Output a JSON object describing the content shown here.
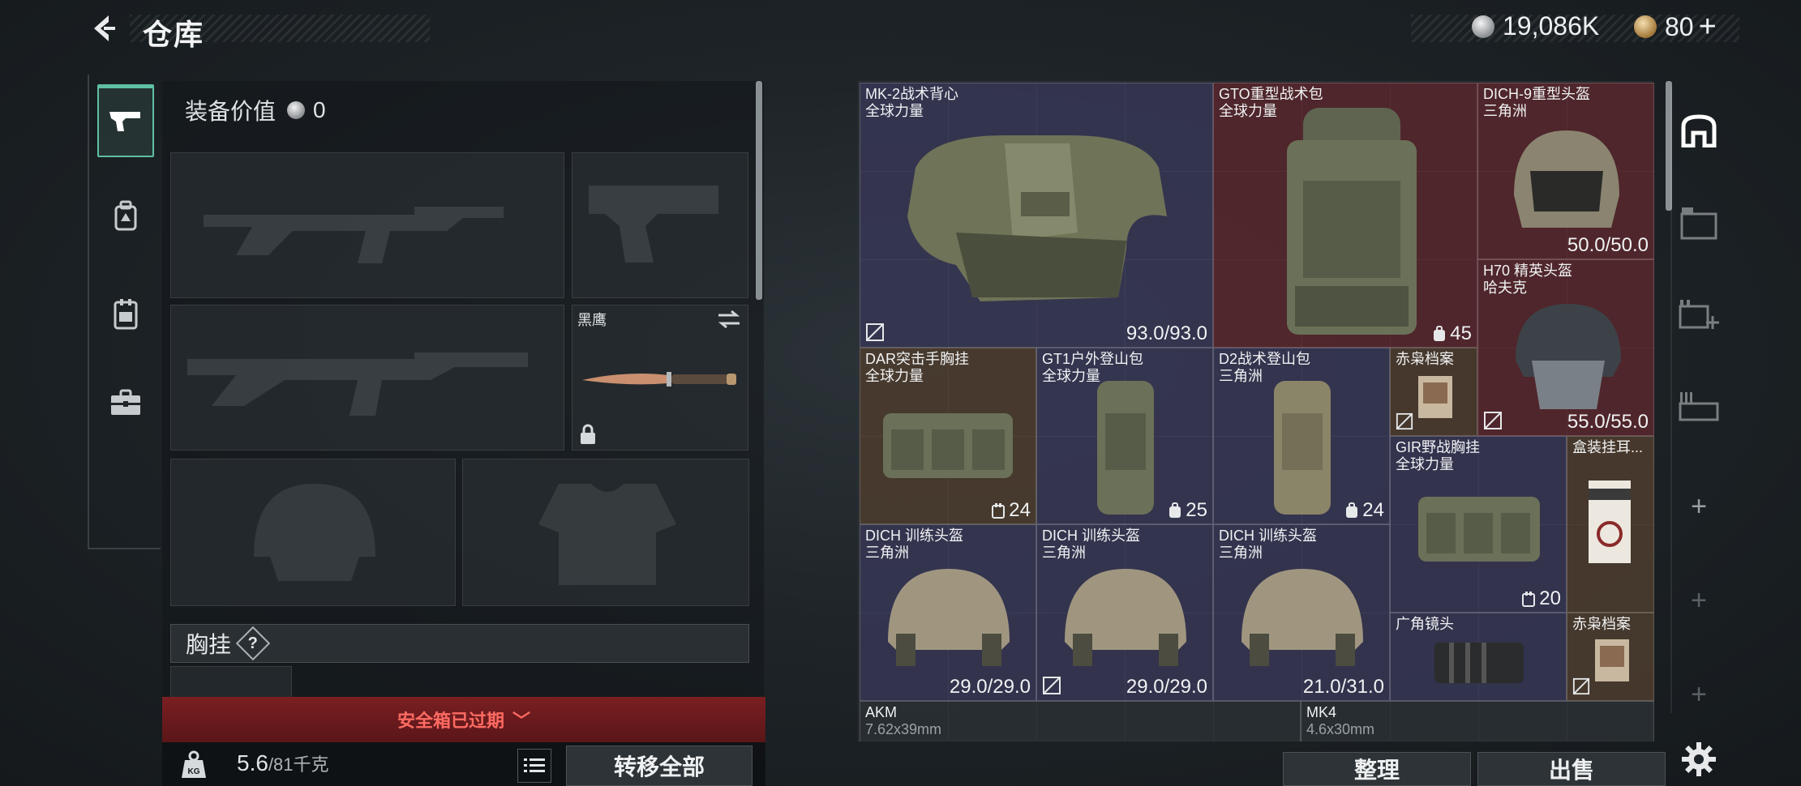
{
  "header": {
    "title": "仓库",
    "back_icon": "back-arrow-icon",
    "currency_silver": "19,086K",
    "currency_gold": "80",
    "add_label": "+"
  },
  "left_nav": {
    "items": [
      {
        "icon": "pistol-icon",
        "active": true
      },
      {
        "icon": "backpack-icon",
        "active": false
      },
      {
        "icon": "chest-rig-icon",
        "active": false
      },
      {
        "icon": "toolbox-icon",
        "active": false
      }
    ]
  },
  "equipment": {
    "value_label": "装备价值",
    "value": "0",
    "melee_label": "黑鹰",
    "vest_label": "胸挂",
    "help_label": "?"
  },
  "safebox": {
    "label": "安全箱已过期",
    "chevron": "﹀"
  },
  "weight": {
    "current": "5.6",
    "max": "/81千克",
    "transfer_label": "转移全部"
  },
  "inventory": {
    "items": [
      {
        "name": "MK-2战术背心",
        "sub": "全球力量",
        "dur": "93.0/93.0",
        "color": "purple"
      },
      {
        "name": "GTO重型战术包",
        "sub": "全球力量",
        "cap": "45",
        "color": "red"
      },
      {
        "name": "DICH-9重型头盔",
        "sub": "三角洲",
        "dur": "50.0/50.0",
        "color": "red"
      },
      {
        "name": "H70 精英头盔",
        "sub": "哈夫克",
        "dur": "55.0/55.0",
        "color": "red"
      },
      {
        "name": "DAR突击手胸挂",
        "sub": "全球力量",
        "cap": "24",
        "color": "brown"
      },
      {
        "name": "GT1户外登山包",
        "sub": "全球力量",
        "cap": "25",
        "color": "purple"
      },
      {
        "name": "D2战术登山包",
        "sub": "三角洲",
        "cap": "24",
        "color": "purple"
      },
      {
        "name": "赤枭档案",
        "sub": "",
        "color": "brown"
      },
      {
        "name": "GIR野战胸挂",
        "sub": "全球力量",
        "cap": "20",
        "color": "purple"
      },
      {
        "name": "盒装挂耳...",
        "sub": "",
        "color": "brown"
      },
      {
        "name": "DICH 训练头盔",
        "sub": "三角洲",
        "dur": "29.0/29.0",
        "color": "purple"
      },
      {
        "name": "DICH 训练头盔",
        "sub": "三角洲",
        "dur": "29.0/29.0",
        "color": "purple"
      },
      {
        "name": "DICH 训练头盔",
        "sub": "三角洲",
        "dur": "21.0/31.0",
        "color": "purple"
      },
      {
        "name": "广角镜头",
        "sub": "",
        "color": "purple"
      },
      {
        "name": "赤枭档案",
        "sub": "",
        "color": "brown"
      },
      {
        "name": "AKM",
        "sub": "7.62x39mm",
        "color": "gray"
      },
      {
        "name": "MK4",
        "sub": "4.6x30mm",
        "color": "gray"
      }
    ],
    "sort_label": "整理",
    "sell_label": "出售"
  },
  "tools": [
    {
      "icon": "safe-house-icon"
    },
    {
      "icon": "storage-crate-icon"
    },
    {
      "icon": "add-storage-icon"
    },
    {
      "icon": "expand-storage-icon"
    },
    {
      "icon": "plus-icon",
      "label": "+"
    },
    {
      "icon": "plus-icon",
      "label": "+"
    },
    {
      "icon": "plus-icon",
      "label": "+"
    }
  ],
  "colors": {
    "accent": "#5fbfa5",
    "danger_bg": "#7a1f22",
    "danger_text": "#ff6b63",
    "rarity_purple": "#46426e",
    "rarity_red": "#6e282e",
    "rarity_gold": "#5f4630"
  }
}
